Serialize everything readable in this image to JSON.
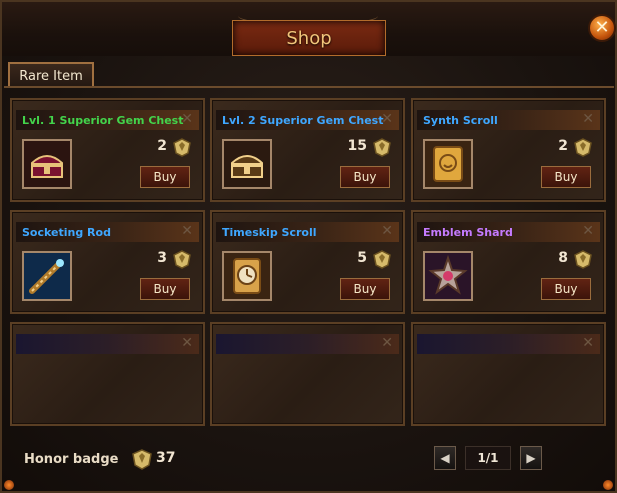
{
  "window": {
    "title": "Shop"
  },
  "tabs": [
    {
      "label": "Rare Item",
      "active": true
    }
  ],
  "items": [
    {
      "name": "Lvl. 1 Superior Gem Chest",
      "name_color": "#43d34b",
      "icon": "gem-chest-icon",
      "price": "2",
      "buy_label": "Buy"
    },
    {
      "name": "Lvl. 2 Superior Gem Chest",
      "name_color": "#3fa7ff",
      "icon": "gem-chest-icon",
      "price": "15",
      "buy_label": "Buy"
    },
    {
      "name": "Synth Scroll",
      "name_color": "#3fa7ff",
      "icon": "scroll-icon",
      "price": "2",
      "buy_label": "Buy"
    },
    {
      "name": "Socketing Rod",
      "name_color": "#3fa7ff",
      "icon": "rod-icon",
      "price": "3",
      "buy_label": "Buy"
    },
    {
      "name": "Timeskip Scroll",
      "name_color": "#3fa7ff",
      "icon": "clock-scroll-icon",
      "price": "5",
      "buy_label": "Buy"
    },
    {
      "name": "Emblem Shard",
      "name_color": "#c57bff",
      "icon": "emblem-shard-icon",
      "price": "8",
      "buy_label": "Buy"
    }
  ],
  "footer": {
    "honor_label": "Honor badge",
    "honor_count": "37",
    "page": "1/1"
  }
}
